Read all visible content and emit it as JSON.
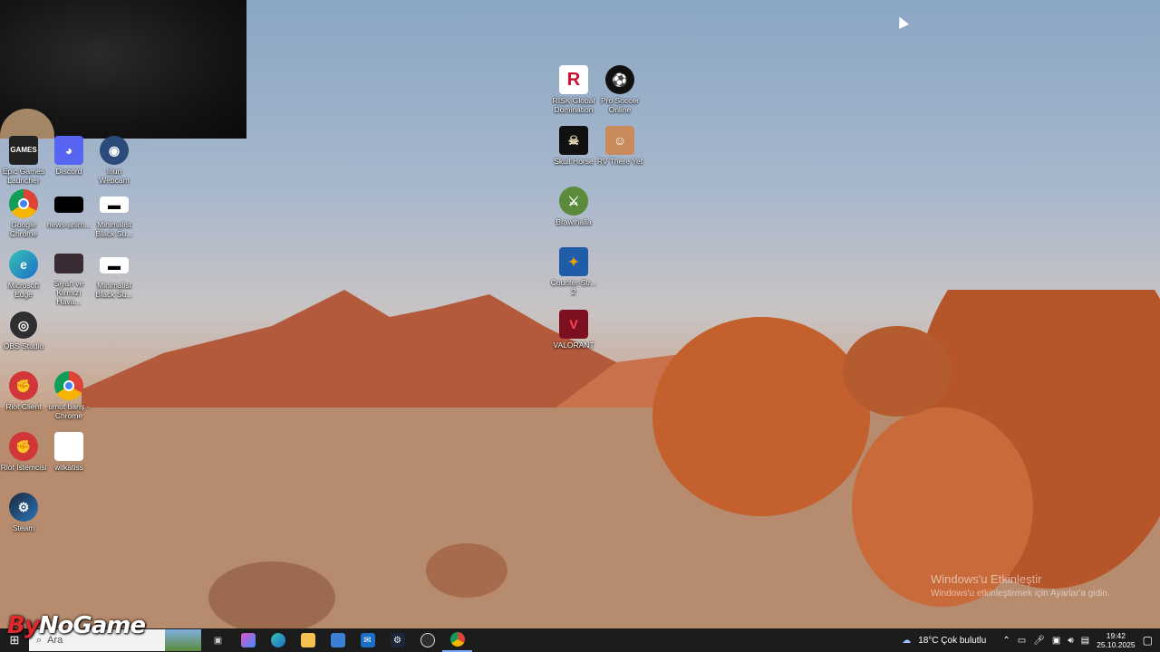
{
  "desktop_icons": {
    "epic": "Epic Games Launcher",
    "discord": "Discord",
    "iriun": "Iriun Webcam",
    "chrome": "Google Chrome",
    "news": "news-anim...",
    "minimalist1": "Minimalist Black Su...",
    "edge": "Microsoft Edge",
    "siyah": "Siyah ve Kırmızı Hava...",
    "minimalist2": "Minimalist Black Su...",
    "obs": "OBS Studio",
    "riot": "Riot Client",
    "umut": "umut barış - Chrome",
    "riot_istemci": "Riot İstemcisi",
    "wilkatiss": "wilkatiss",
    "steam": "Steam",
    "risk": "RISK Global Domination",
    "pro_soccer": "Pro Soccer Online",
    "skull": "Skull Horse",
    "rv": "RV There Yet",
    "brawlhalla": "Brawlhalla",
    "counter": "Counter-Str... 2",
    "valorant": "VALORANT"
  },
  "activation": {
    "title": "Windows'u Etkinleştir",
    "subtitle": "Windows'u etkinleştirmek için Ayarlar'a gidin."
  },
  "watermark": {
    "by": "By",
    "rest": "NoGame"
  },
  "taskbar": {
    "search_glyph": "⌕",
    "search_text": "Ara",
    "weather": "18°C  Çok bulutlu",
    "time": "19:42",
    "date": "25.10.2025"
  },
  "colors": {
    "taskbar": "#1c1c1c",
    "riot_red": "#d13639",
    "valorant_red": "#ff4655"
  }
}
